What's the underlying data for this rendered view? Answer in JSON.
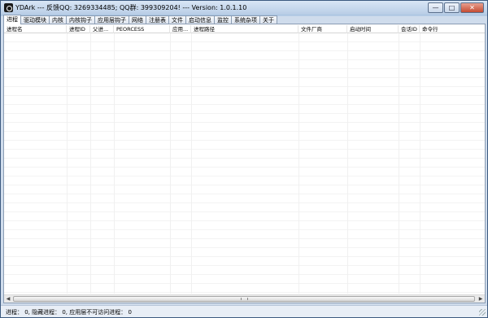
{
  "window": {
    "title": "YDArk --- 反馈QQ: 3269334485; QQ群: 399309204! --- Version: 1.0.1.10",
    "controls": {
      "minimize": "—",
      "maximize": "□",
      "close": "✕"
    }
  },
  "tabs": [
    "进程",
    "驱动模块",
    "内核",
    "内核钩子",
    "应用层钩子",
    "网络",
    "注册表",
    "文件",
    "启动信息",
    "监控",
    "系统杂项",
    "关于"
  ],
  "active_tab": "进程",
  "table": {
    "columns": [
      "进程名",
      "进程ID",
      "父进...",
      "PEORCESS",
      "应用...",
      "进程路径",
      "文件厂商",
      "启动时间",
      "会话ID",
      "命令行"
    ],
    "rows": []
  },
  "status": {
    "text": "进程： 0, 隐藏进程： 0, 应用层不可访问进程： 0"
  }
}
